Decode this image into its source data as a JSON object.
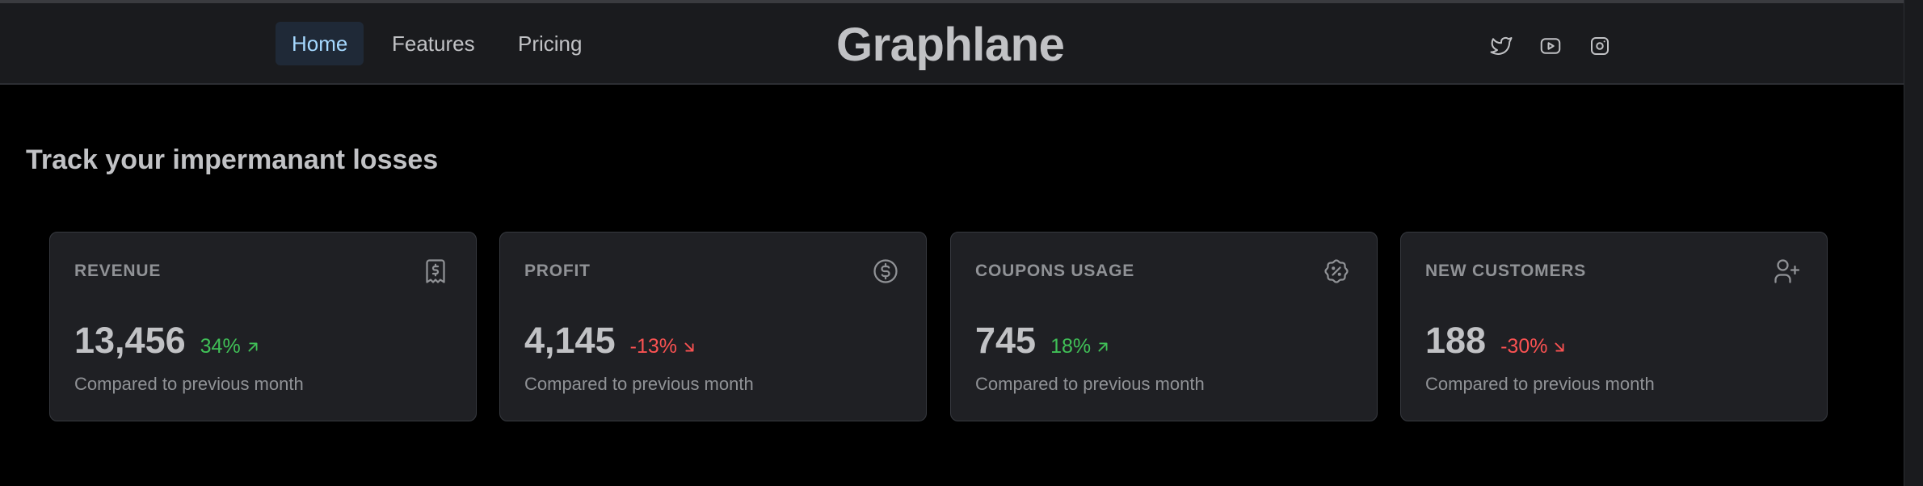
{
  "nav": {
    "links": [
      {
        "label": "Home"
      },
      {
        "label": "Features"
      },
      {
        "label": "Pricing"
      }
    ],
    "brand": "Graphlane",
    "socials": [
      "twitter-icon",
      "youtube-icon",
      "instagram-icon"
    ]
  },
  "main": {
    "title": "Track your impermanant losses"
  },
  "stats": [
    {
      "title": "REVENUE",
      "value": "13,456",
      "diff": "34%",
      "trend": "up",
      "icon": "receipt-icon",
      "caption": "Compared to previous month"
    },
    {
      "title": "PROFIT",
      "value": "4,145",
      "diff": "-13%",
      "trend": "down",
      "icon": "coin-icon",
      "caption": "Compared to previous month"
    },
    {
      "title": "COUPONS USAGE",
      "value": "745",
      "diff": "18%",
      "trend": "up",
      "icon": "discount-icon",
      "caption": "Compared to previous month"
    },
    {
      "title": "NEW CUSTOMERS",
      "value": "188",
      "diff": "-30%",
      "trend": "down",
      "icon": "user-plus-icon",
      "caption": "Compared to previous month"
    }
  ],
  "colors": {
    "background": "#000000",
    "header": "#1a1b1e",
    "card": "#1f2024",
    "positive": "#40c057",
    "negative": "#fa5252",
    "active_link": "#a5d8ff"
  }
}
